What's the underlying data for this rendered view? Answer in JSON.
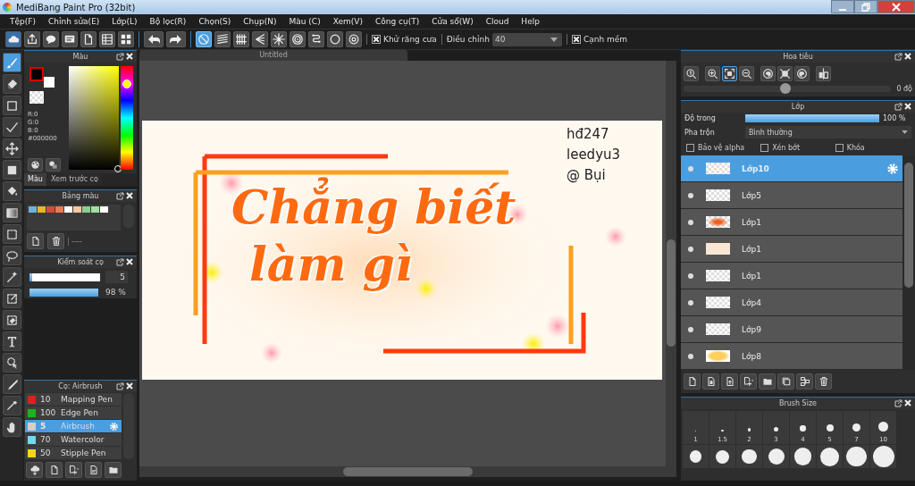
{
  "window": {
    "title": "MediBang Paint Pro (32bit)"
  },
  "menu": [
    "Tệp(F)",
    "Chỉnh sửa(E)",
    "Lớp(L)",
    "Bộ lọc(R)",
    "Chọn(S)",
    "Chụp(N)",
    "Màu (C)",
    "Xem(V)",
    "Công cụ(T)",
    "Cửa sổ(W)",
    "Cloud",
    "Help"
  ],
  "toolbar": {
    "file_buttons": [
      {
        "kind": "cloud"
      },
      {
        "kind": "share"
      },
      {
        "kind": "speech"
      },
      {
        "kind": "message"
      },
      {
        "kind": "document"
      },
      {
        "kind": "list"
      },
      {
        "kind": "grid"
      }
    ],
    "history": [
      {
        "kind": "undo"
      },
      {
        "kind": "redo"
      }
    ],
    "snaps": [
      {
        "kind": "ban",
        "selected": true
      },
      {
        "kind": "parallel",
        "selected": false
      },
      {
        "kind": "bars",
        "selected": false
      },
      {
        "kind": "perspective",
        "selected": false
      },
      {
        "kind": "radial",
        "selected": false
      },
      {
        "kind": "concentric",
        "selected": false
      },
      {
        "kind": "curve",
        "selected": false
      },
      {
        "kind": "circle",
        "selected": false
      },
      {
        "kind": "gear",
        "selected": false
      }
    ],
    "antialias": {
      "label": "Khử răng cưa",
      "checked": true
    },
    "correction": {
      "label": "Điều chỉnh",
      "value": "40"
    },
    "soft_edge": {
      "label": "Cạnh mềm",
      "checked": true
    }
  },
  "tools": [
    {
      "kind": "brush",
      "selected": true
    },
    {
      "kind": "eraser",
      "selected": false
    },
    {
      "kind": "square",
      "selected": false
    },
    {
      "kind": "polyline",
      "selected": false
    },
    {
      "kind": "move",
      "selected": false
    },
    {
      "kind": "fill-square",
      "selected": false
    },
    {
      "kind": "bucket",
      "selected": false
    },
    {
      "kind": "gradient",
      "selected": false
    },
    {
      "kind": "dashed-square",
      "selected": false
    },
    {
      "kind": "lasso",
      "selected": false
    },
    {
      "kind": "wand",
      "selected": false
    },
    {
      "kind": "pen",
      "selected": false
    },
    {
      "kind": "dotted-eraser",
      "selected": false
    },
    {
      "kind": "text",
      "selected": false
    },
    {
      "kind": "pointer",
      "selected": false
    },
    {
      "kind": "knife",
      "selected": false
    },
    {
      "kind": "eyedropper",
      "selected": false
    },
    {
      "kind": "hand",
      "selected": false
    }
  ],
  "color_panel": {
    "title": "Màu",
    "swatches": [
      {
        "color": "#000000"
      },
      {
        "color": "#ffffff"
      }
    ],
    "rgb": [
      "R:0",
      "G:0",
      "B:0"
    ],
    "hex": "#000000",
    "hue_slider": {
      "level": 0.83
    },
    "tabs": [
      {
        "label": "Màu",
        "selected": true
      },
      {
        "label": "Xem trước cọ",
        "selected": false
      }
    ]
  },
  "palette": {
    "title": "Bảng màu",
    "colors": [
      {
        "color": "#6fb4d8"
      },
      {
        "color": "#e8b820"
      },
      {
        "color": "#d84a3a"
      },
      {
        "color": "#f07850"
      },
      {
        "color": "#ffffff"
      },
      {
        "color": "#f8c8a0"
      },
      {
        "color": "#88d090"
      },
      {
        "color": "#a0e0a0"
      },
      {
        "color": "#ffffff"
      }
    ],
    "name": "----"
  },
  "brush_control": {
    "title": "Kiểm soát cọ",
    "size": {
      "level": 0.04,
      "value": "5"
    },
    "opacity": {
      "level": 0.98,
      "value": "98 %"
    }
  },
  "brushes": {
    "title": "Cọ: Airbrush",
    "items": [
      {
        "size": "10",
        "name": "Mapping Pen",
        "color": "#e02020",
        "selected": false
      },
      {
        "size": "100",
        "name": "Edge Pen",
        "color": "#20b020",
        "selected": false
      },
      {
        "size": "5",
        "name": "Airbrush",
        "color": "#d0d0d0",
        "selected": true
      },
      {
        "size": "70",
        "name": "Watercolor",
        "color": "#70d8f0",
        "selected": false
      },
      {
        "size": "50",
        "name": "Stipple Pen",
        "color": "#f0d820",
        "selected": false
      }
    ],
    "buttons": [
      {
        "kind": "cloud-down"
      },
      {
        "kind": "document"
      },
      {
        "kind": "add-menu"
      },
      {
        "kind": "document-edit"
      },
      {
        "kind": "folder"
      }
    ]
  },
  "canvas": {
    "tab": "Untitled",
    "lettering": [
      "Chẳng biết",
      "làm gì"
    ],
    "signature": [
      "hđ247",
      "leedyu3",
      "@ Bụi"
    ]
  },
  "navigator": {
    "title": "Hoa tiêu",
    "buttons": [
      {
        "kind": "zoom-actual",
        "selected": false
      },
      {
        "kind": "zoom-in",
        "selected": false
      },
      {
        "kind": "fit",
        "selected": true
      },
      {
        "kind": "zoom-out",
        "selected": false
      },
      {
        "kind": "rotate-left",
        "selected": false
      },
      {
        "kind": "frame",
        "selected": false
      },
      {
        "kind": "rotate-right",
        "selected": false
      },
      {
        "kind": "flip",
        "selected": false
      }
    ],
    "rotation": {
      "level": 0.49,
      "value": "0 độ"
    }
  },
  "layers": {
    "title": "Lớp",
    "opacity": {
      "label": "Độ trong",
      "level": 1,
      "value": "100 %"
    },
    "blend": {
      "label": "Pha trộn",
      "value": "Bình thường"
    },
    "options": [
      {
        "label": "Bảo vệ alpha",
        "checked": false
      },
      {
        "label": "Xén bớt",
        "checked": false
      },
      {
        "label": "Khóa",
        "checked": false
      }
    ],
    "items": [
      {
        "name": "Lớp10",
        "selected": true,
        "kind": "empty"
      },
      {
        "name": "Lớp5",
        "selected": false,
        "kind": "empty"
      },
      {
        "name": "Lớp1",
        "selected": false,
        "kind": "sketch"
      },
      {
        "name": "Lớp1",
        "selected": false,
        "kind": "peach"
      },
      {
        "name": "Lớp1",
        "selected": false,
        "kind": "empty"
      },
      {
        "name": "Lớp4",
        "selected": false,
        "kind": "empty"
      },
      {
        "name": "Lớp9",
        "selected": false,
        "kind": "empty"
      },
      {
        "name": "Lớp8",
        "selected": false,
        "kind": "yellow"
      }
    ],
    "buttons": [
      {
        "kind": "document"
      },
      {
        "kind": "document-copy"
      },
      {
        "kind": "document-up"
      },
      {
        "kind": "add-menu"
      },
      {
        "kind": "folder"
      },
      {
        "kind": "duplicate"
      },
      {
        "kind": "merge"
      },
      {
        "kind": "trash"
      }
    ]
  },
  "brush_size": {
    "title": "Brush Size",
    "sizes": [
      "1",
      "1.5",
      "2",
      "3",
      "4",
      "5",
      "7",
      "10"
    ]
  }
}
